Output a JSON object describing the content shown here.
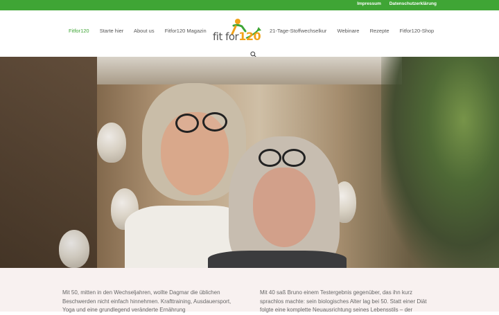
{
  "topbar": {
    "links": [
      "Impressum",
      "Datenschutzerklärung"
    ]
  },
  "nav": {
    "left": [
      "Fitfor120",
      "Starte hier",
      "About us",
      "Fitfor120 Magazin"
    ],
    "right": [
      "21-Tage-Stoffwechselkur",
      "Webinare",
      "Rezepte",
      "Fitfor120-Shop"
    ]
  },
  "logo": {
    "text": "fit for",
    "number": "120"
  },
  "colors": {
    "brand_green": "#3fa535",
    "brand_orange": "#f0a21a"
  },
  "icons": {
    "search": "search-icon"
  },
  "hero": {
    "image": "couple-portrait-photo"
  },
  "intro": {
    "col1": "Mit 50, mitten in den Wechseljahren, wollte Dagmar die üblichen Beschwerden nicht einfach hinnehmen. Krafttraining, Ausdauersport, Yoga und eine grundlegend veränderte Ernährung",
    "col2": "Mit 40 saß Bruno einem Testergebnis gegenüber, das ihn kurz sprachlos machte: sein biologisches Alter lag bei 50. Statt einer Diät folgte eine komplette Neuausrichtung seines Lebensstils – der"
  }
}
